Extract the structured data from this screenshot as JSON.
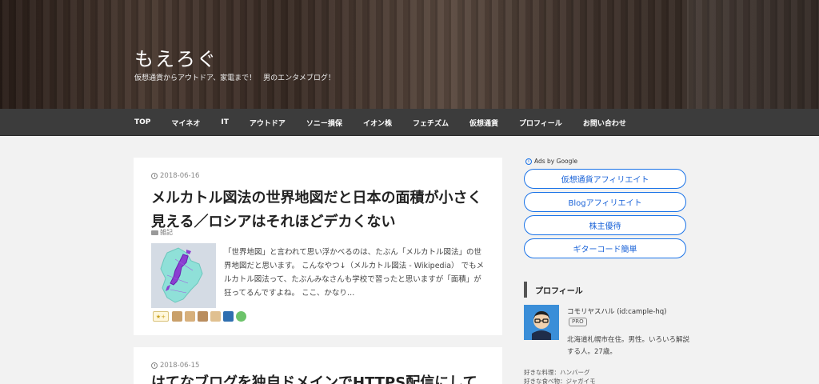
{
  "site": {
    "title": "もえろぐ",
    "description": "仮想通貨からアウトドア、家電まで！　男のエンタメブログ！"
  },
  "nav": {
    "items": [
      "TOP",
      "マイネオ",
      "IT",
      "アウトドア",
      "ソニー損保",
      "イオン株",
      "フェチズム",
      "仮想通貨",
      "プロフィール",
      "お問い合わせ"
    ]
  },
  "articles": [
    {
      "date": "2018-06-16",
      "title": "メルカトル図法の世界地図だと日本の面積が小さく見える／ロシアはそれほどデカくない",
      "category": "雑記",
      "excerpt": "「世界地図」と言われて思い浮かべるのは、たぶん「メルカトル図法」の世界地図だと思います。 こんなやつ↓（メルカトル図法 - Wikipedia） でもメルカトル図法って、たぶんみなさんも学校で習ったと思いますが「面積」が狂ってるんですよね。 ここ、かなり…",
      "star_label": "★+"
    },
    {
      "date": "2018-06-15",
      "title": "はてなブログを独自ドメインでHTTPS配信にして"
    }
  ],
  "sidebar": {
    "ads_label": "Ads by Google",
    "ads_icon_glyph": "i",
    "ads_buttons": [
      "仮想通貨アフィリエイト",
      "Blogアフィリエイト",
      "株主優待",
      "ギターコード簡単"
    ],
    "profile": {
      "heading": "プロフィール",
      "name": "コモリヤスハル (id:cample-hq)",
      "badge": "PRO",
      "description": "北海道札幌市在住。男性。いろいろ解説する人。27歳。",
      "extra_1": "好きな料理：ハンバーグ",
      "extra_2": "好きな食べ物：ジャガイモ"
    }
  },
  "colors": {
    "accent": "#1a73e8",
    "nav_bg": "#3c3c3c",
    "page_bg": "#f2f2f2"
  }
}
